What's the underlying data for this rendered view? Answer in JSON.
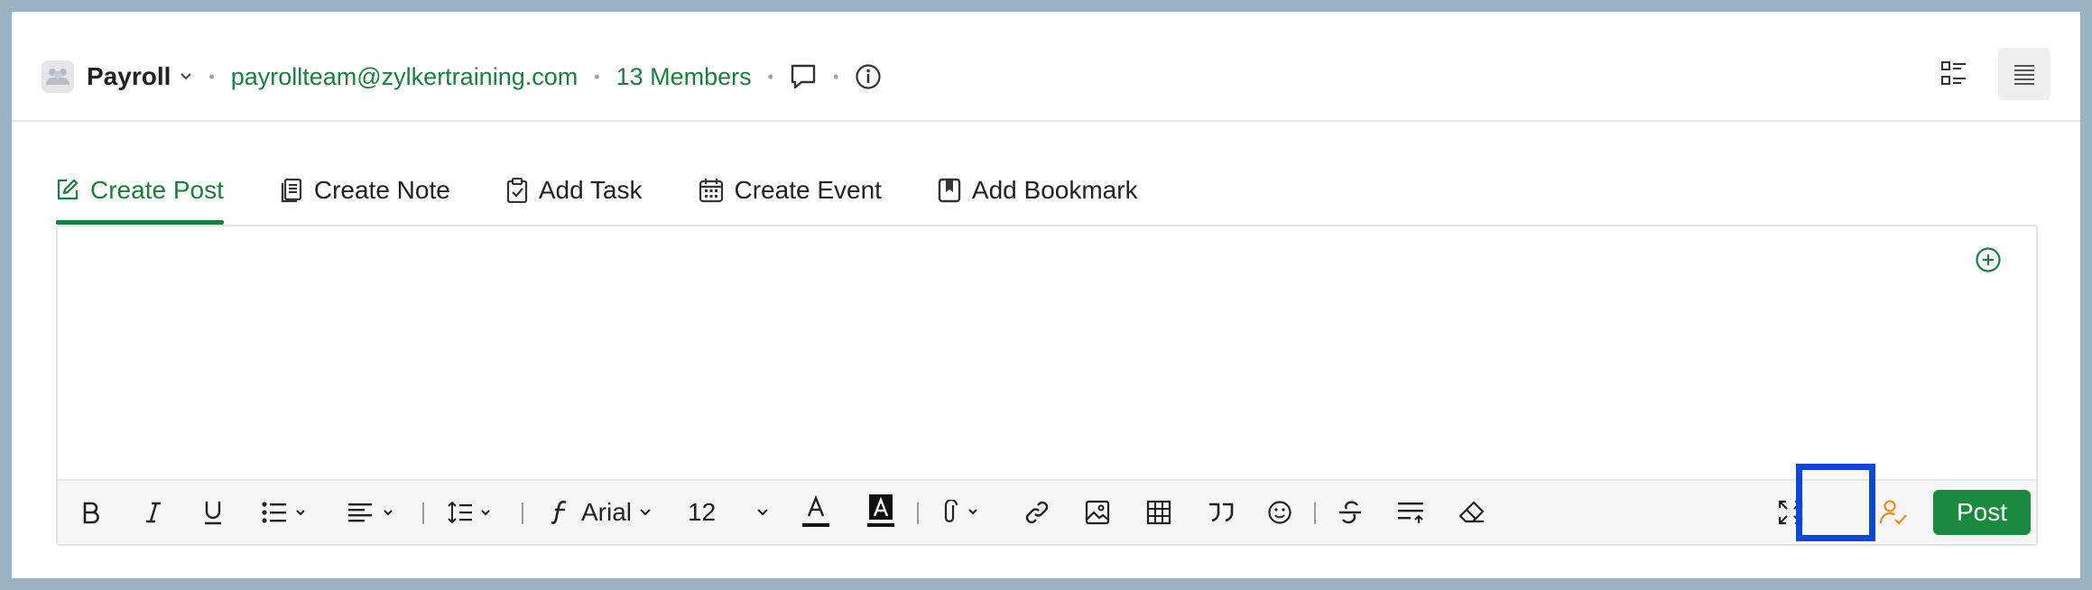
{
  "header": {
    "group_name": "Payroll",
    "email": "payrollteam@zylkertraining.com",
    "members": "13 Members",
    "icons": [
      "group-avatar-icon",
      "chevron-down-icon",
      "comment-icon",
      "info-icon",
      "list-view-icon",
      "compact-view-icon"
    ]
  },
  "tabs": [
    {
      "label": "Create Post",
      "icon": "edit-icon",
      "active": true
    },
    {
      "label": "Create Note",
      "icon": "note-icon",
      "active": false
    },
    {
      "label": "Add Task",
      "icon": "clipboard-check-icon",
      "active": false
    },
    {
      "label": "Create Event",
      "icon": "calendar-icon",
      "active": false
    },
    {
      "label": "Add Bookmark",
      "icon": "bookmark-icon",
      "active": false
    }
  ],
  "toolbar": {
    "font_name": "Arial",
    "font_size": "12",
    "post_label": "Post"
  },
  "colors": {
    "accent": "#1a7f3c",
    "post_button": "#1a8a3e",
    "highlight": "#0c47d6",
    "mention_icon": "#f08a24"
  }
}
